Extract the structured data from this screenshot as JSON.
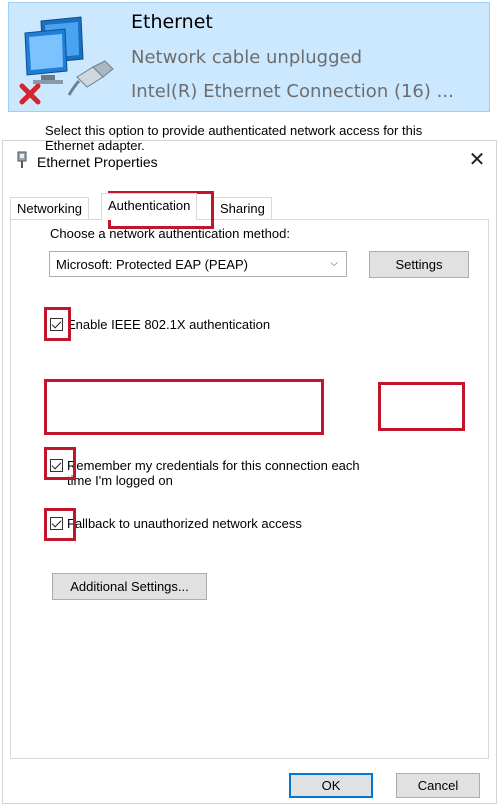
{
  "adapter": {
    "name": "Ethernet",
    "status": "Network cable unplugged",
    "device": "Intel(R) Ethernet Connection (16) ..."
  },
  "window": {
    "title": "Ethernet Properties",
    "close_glyph": "✕"
  },
  "tabs": [
    {
      "label": "Networking",
      "active": false
    },
    {
      "label": "Authentication",
      "active": true
    },
    {
      "label": "Sharing",
      "active": false
    }
  ],
  "auth": {
    "description": "Select this option to provide authenticated network access for this Ethernet adapter.",
    "enable_8021x": {
      "label": "Enable IEEE 802.1X authentication",
      "checked": true
    },
    "method_label": "Choose a network authentication method:",
    "method_selected": "Microsoft: Protected EAP (PEAP)",
    "settings_label": "Settings",
    "remember_creds": {
      "label_line1": "Remember my credentials for this connection each",
      "label_line2": "time I'm logged on",
      "checked": true
    },
    "fallback": {
      "label": "Fallback to unauthorized network access",
      "checked": true
    },
    "additional_settings_label": "Additional Settings..."
  },
  "footer": {
    "ok_label": "OK",
    "cancel_label": "Cancel"
  },
  "colors": {
    "highlight": "#c0152a",
    "adapter_selected_bg": "#cce8ff",
    "button_bg": "#e1e1e1",
    "default_button_border": "#0078d7"
  },
  "icons": {
    "adapter": "network-adapter-icon",
    "disconnected": "red-x-icon",
    "window": "network-adapter-small-icon",
    "dropdown": "chevron-down-icon"
  }
}
